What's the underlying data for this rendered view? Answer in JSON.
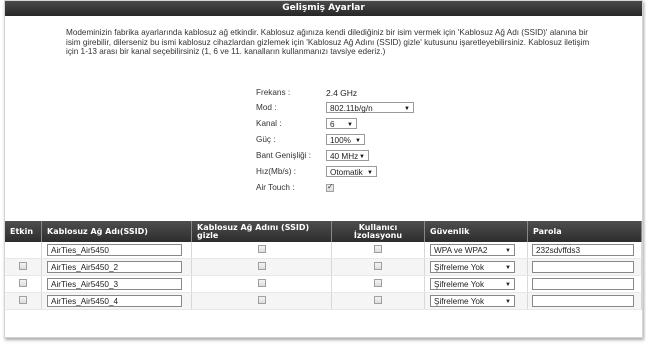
{
  "header": {
    "title": "Gelişmiş Ayarlar"
  },
  "description": "Modeminizin fabrika ayarlarında kablosuz ağ etkindir. Kablosuz ağınıza kendi dilediğiniz bir isim vermek için 'Kablosuz Ağ Adı (SSID)' alanına bir isim girebilir, dilerseniz bu ismi kablosuz cihazlardan gizlemek için 'Kablosuz Ağ Adını (SSID) gizle' kutusunu işaretleyebilirsiniz. Kablosuz iletişim için 1-13 arası bir kanal seçebilirsiniz (1, 6 ve 11. kanalların kullanmanızı tavsiye ederiz.)",
  "form": {
    "frekans_label": "Frekans :",
    "frekans_value": "2.4 GHz",
    "mod_label": "Mod :",
    "mod_value": "802.11b/g/n",
    "kanal_label": "Kanal :",
    "kanal_value": "6",
    "guc_label": "Güç :",
    "guc_value": "100%",
    "bant_label": "Bant Genişliği :",
    "bant_value": "40 MHz",
    "hiz_label": "Hız(Mb/s) :",
    "hiz_value": "Otomatik",
    "airtouch_label": "Air Touch :",
    "airtouch_checked": true
  },
  "table": {
    "headers": {
      "etkin": "Etkin",
      "ssid": "Kablosuz Ağ Adı(SSID)",
      "hide": "Kablosuz Ağ Adını (SSID) gizle",
      "isolation": "Kullanıcı İzolasyonu",
      "security": "Güvenlik",
      "password": "Parola"
    },
    "rows": [
      {
        "ssid": "AirTies_Air5450",
        "security": "WPA ve WPA2",
        "password": "232sdvffds3",
        "enable_checkbox": false
      },
      {
        "ssid": "AirTies_Air5450_2",
        "security": "Şifreleme Yok",
        "password": "",
        "enable_checkbox": true
      },
      {
        "ssid": "AirTies_Air5450_3",
        "security": "Şifreleme Yok",
        "password": "",
        "enable_checkbox": true
      },
      {
        "ssid": "AirTies_Air5450_4",
        "security": "Şifreleme Yok",
        "password": "",
        "enable_checkbox": true
      }
    ]
  }
}
